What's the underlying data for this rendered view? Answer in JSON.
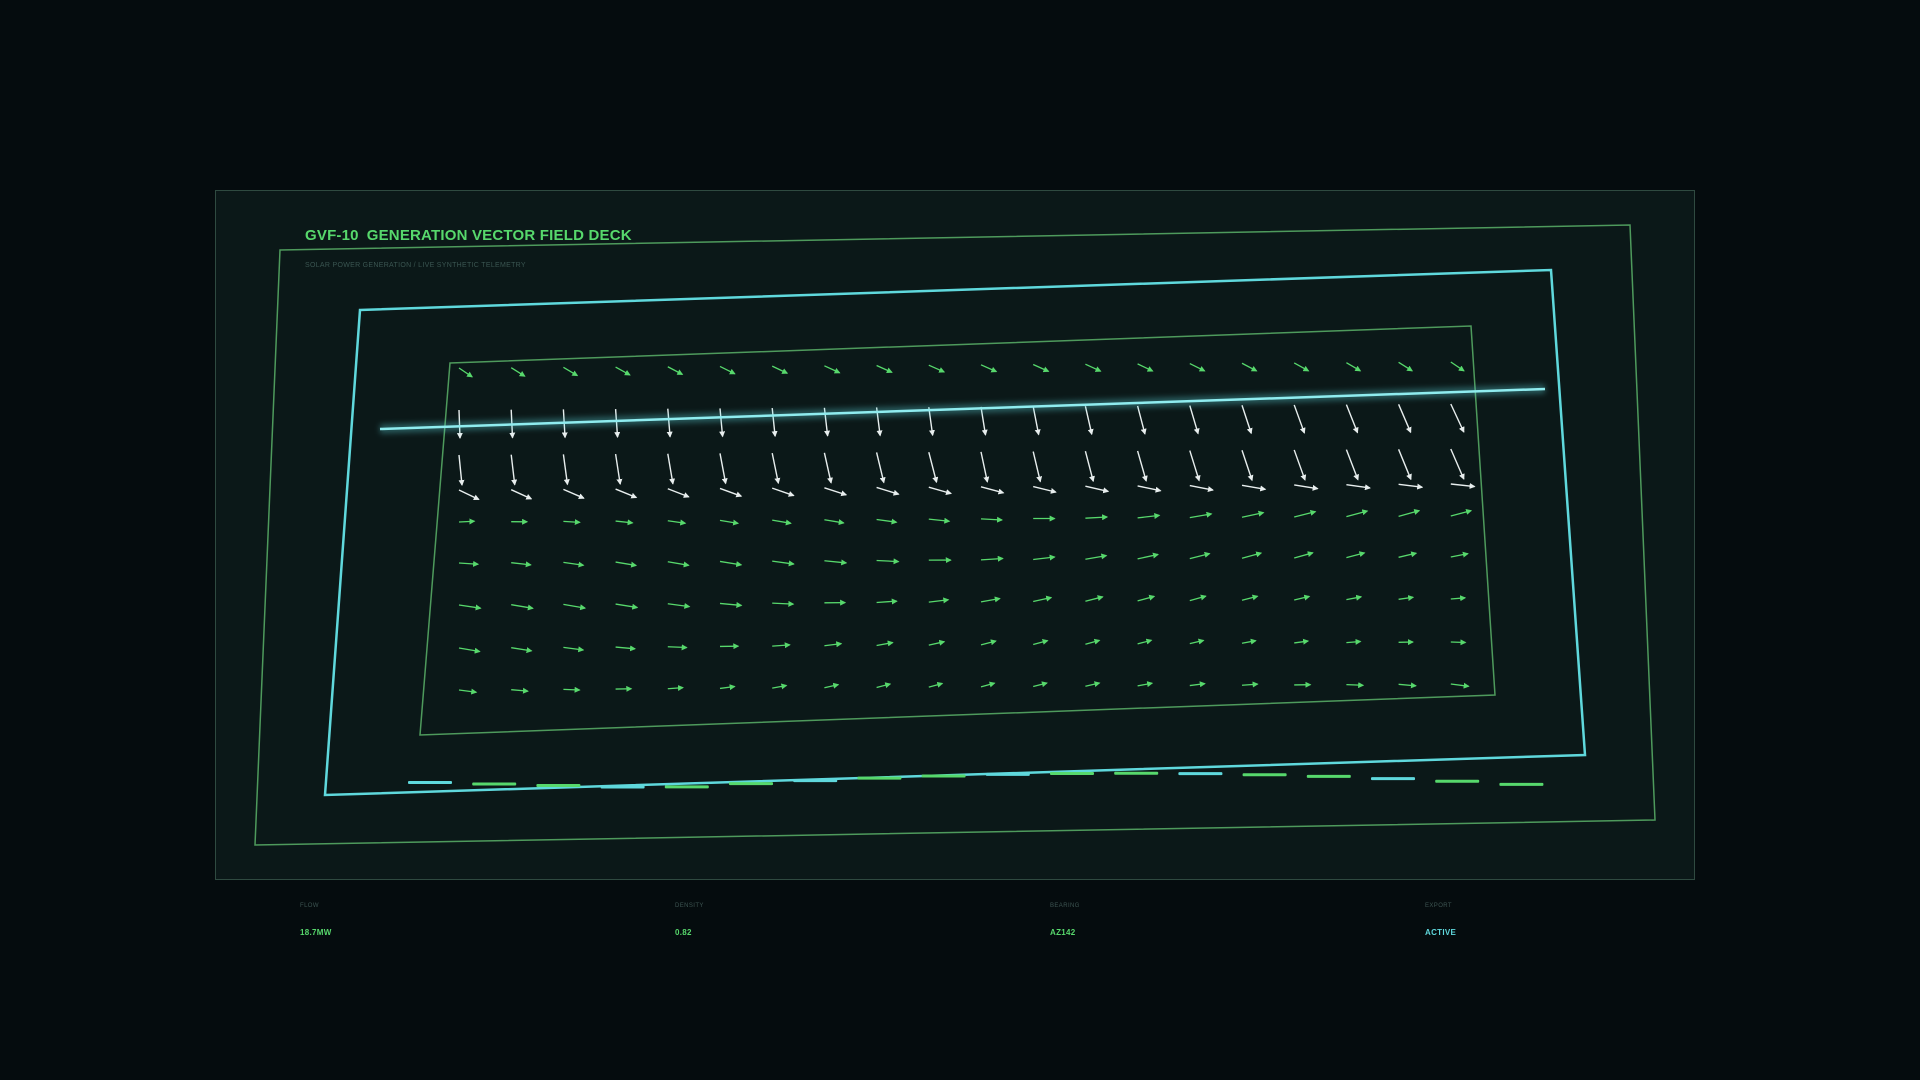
{
  "header": {
    "code": "GVF-10",
    "title": "GENERATION VECTOR FIELD DECK",
    "subtitle": "SOLAR POWER GENERATION / LIVE SYNTHETIC TELEMETRY"
  },
  "stats": [
    {
      "label": "FLOW",
      "value": "18.7MW"
    },
    {
      "label": "DENSITY",
      "value": "0.82"
    },
    {
      "label": "BEARING",
      "value": "AZ142"
    },
    {
      "label": "EXPORT",
      "value": "ACTIVE"
    }
  ],
  "colors": {
    "accent_green": "#57d86c",
    "accent_cyan": "#5fd8dc",
    "vector_white": "#e8eeee",
    "frame_green": "#4e9a5c",
    "background": "#050c0e",
    "panel": "#0b1818"
  },
  "vector_field": {
    "columns": 20,
    "rows": 9,
    "row_colors": [
      "green",
      "white",
      "white",
      "white",
      "green",
      "green",
      "green",
      "green",
      "green"
    ]
  },
  "bar_segments": {
    "colors": [
      "cyan",
      "green",
      "green",
      "cyan",
      "green",
      "green",
      "cyan",
      "green",
      "green",
      "cyan",
      "green",
      "green",
      "cyan",
      "green",
      "green",
      "cyan",
      "green",
      "green"
    ]
  }
}
